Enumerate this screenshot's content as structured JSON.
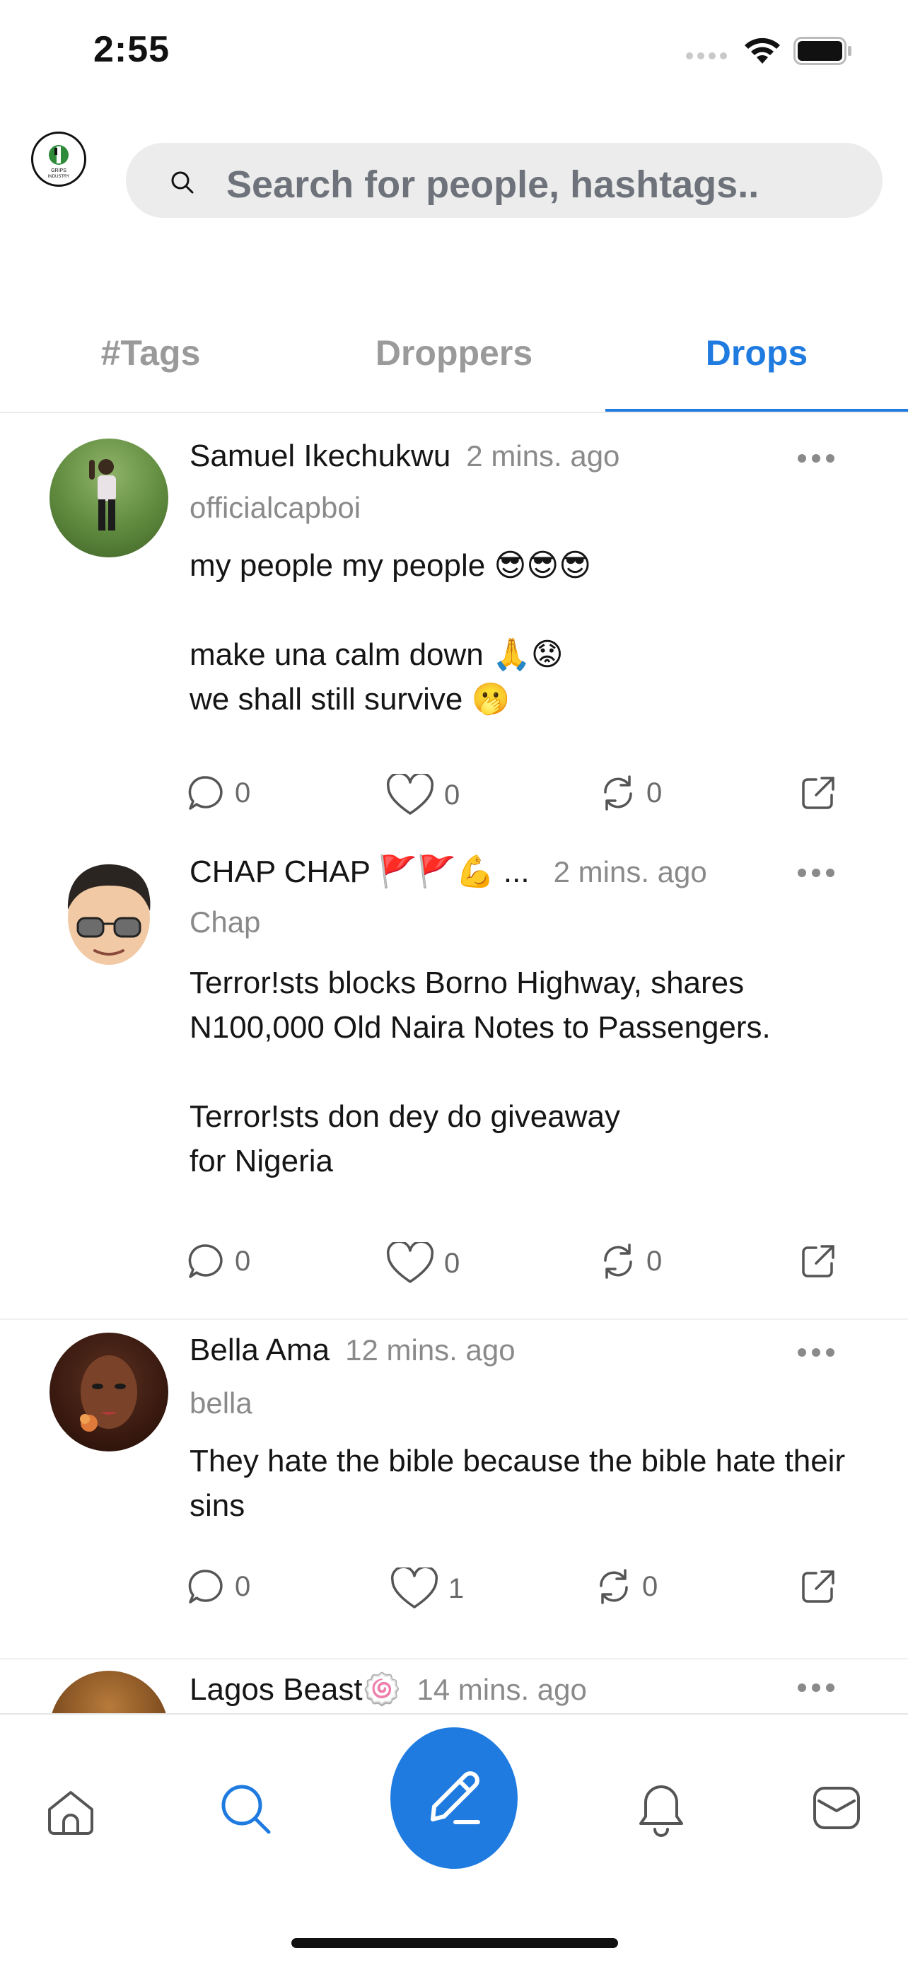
{
  "status_bar": {
    "time": "2:55"
  },
  "header": {
    "logo_text": "GRIPS INDUSTRY",
    "search_placeholder": "Search for people, hashtags.."
  },
  "tabs": [
    {
      "label": "#Tags",
      "active": false
    },
    {
      "label": "Droppers",
      "active": false
    },
    {
      "label": "Drops",
      "active": true
    }
  ],
  "accent_color": "#1f7be0",
  "posts": [
    {
      "author": "Samuel Ikechukwu",
      "time": "2 mins. ago",
      "handle": "officialcapboi",
      "text": "my people my people 😎😎😎\n\nmake una calm down 🙏😟\nwe shall still survive 🫢",
      "comments": "0",
      "likes": "0",
      "redrops": "0"
    },
    {
      "author": "CHAP CHAP 🚩🚩💪 ...",
      "time": "2 mins. ago",
      "handle": "Chap",
      "text": "Terror!sts blocks Borno Highway, shares N100,000 Old Naira Notes to Passengers.\n\nTerror!sts don dey do giveaway\nfor Nigeria",
      "comments": "0",
      "likes": "0",
      "redrops": "0"
    },
    {
      "author": "Bella Ama",
      "time": "12 mins. ago",
      "handle": "bella",
      "text": "They hate the bible because the bible hate their sins",
      "comments": "0",
      "likes": "1",
      "redrops": "0"
    },
    {
      "author": "Lagos Beast🍥",
      "time": "14 mins. ago"
    }
  ],
  "bottom_nav": [
    {
      "icon": "home-icon",
      "active": false
    },
    {
      "icon": "search-icon",
      "active": true
    },
    {
      "icon": "compose-icon",
      "active": false
    },
    {
      "icon": "bell-icon",
      "active": false
    },
    {
      "icon": "mail-icon",
      "active": false
    }
  ]
}
